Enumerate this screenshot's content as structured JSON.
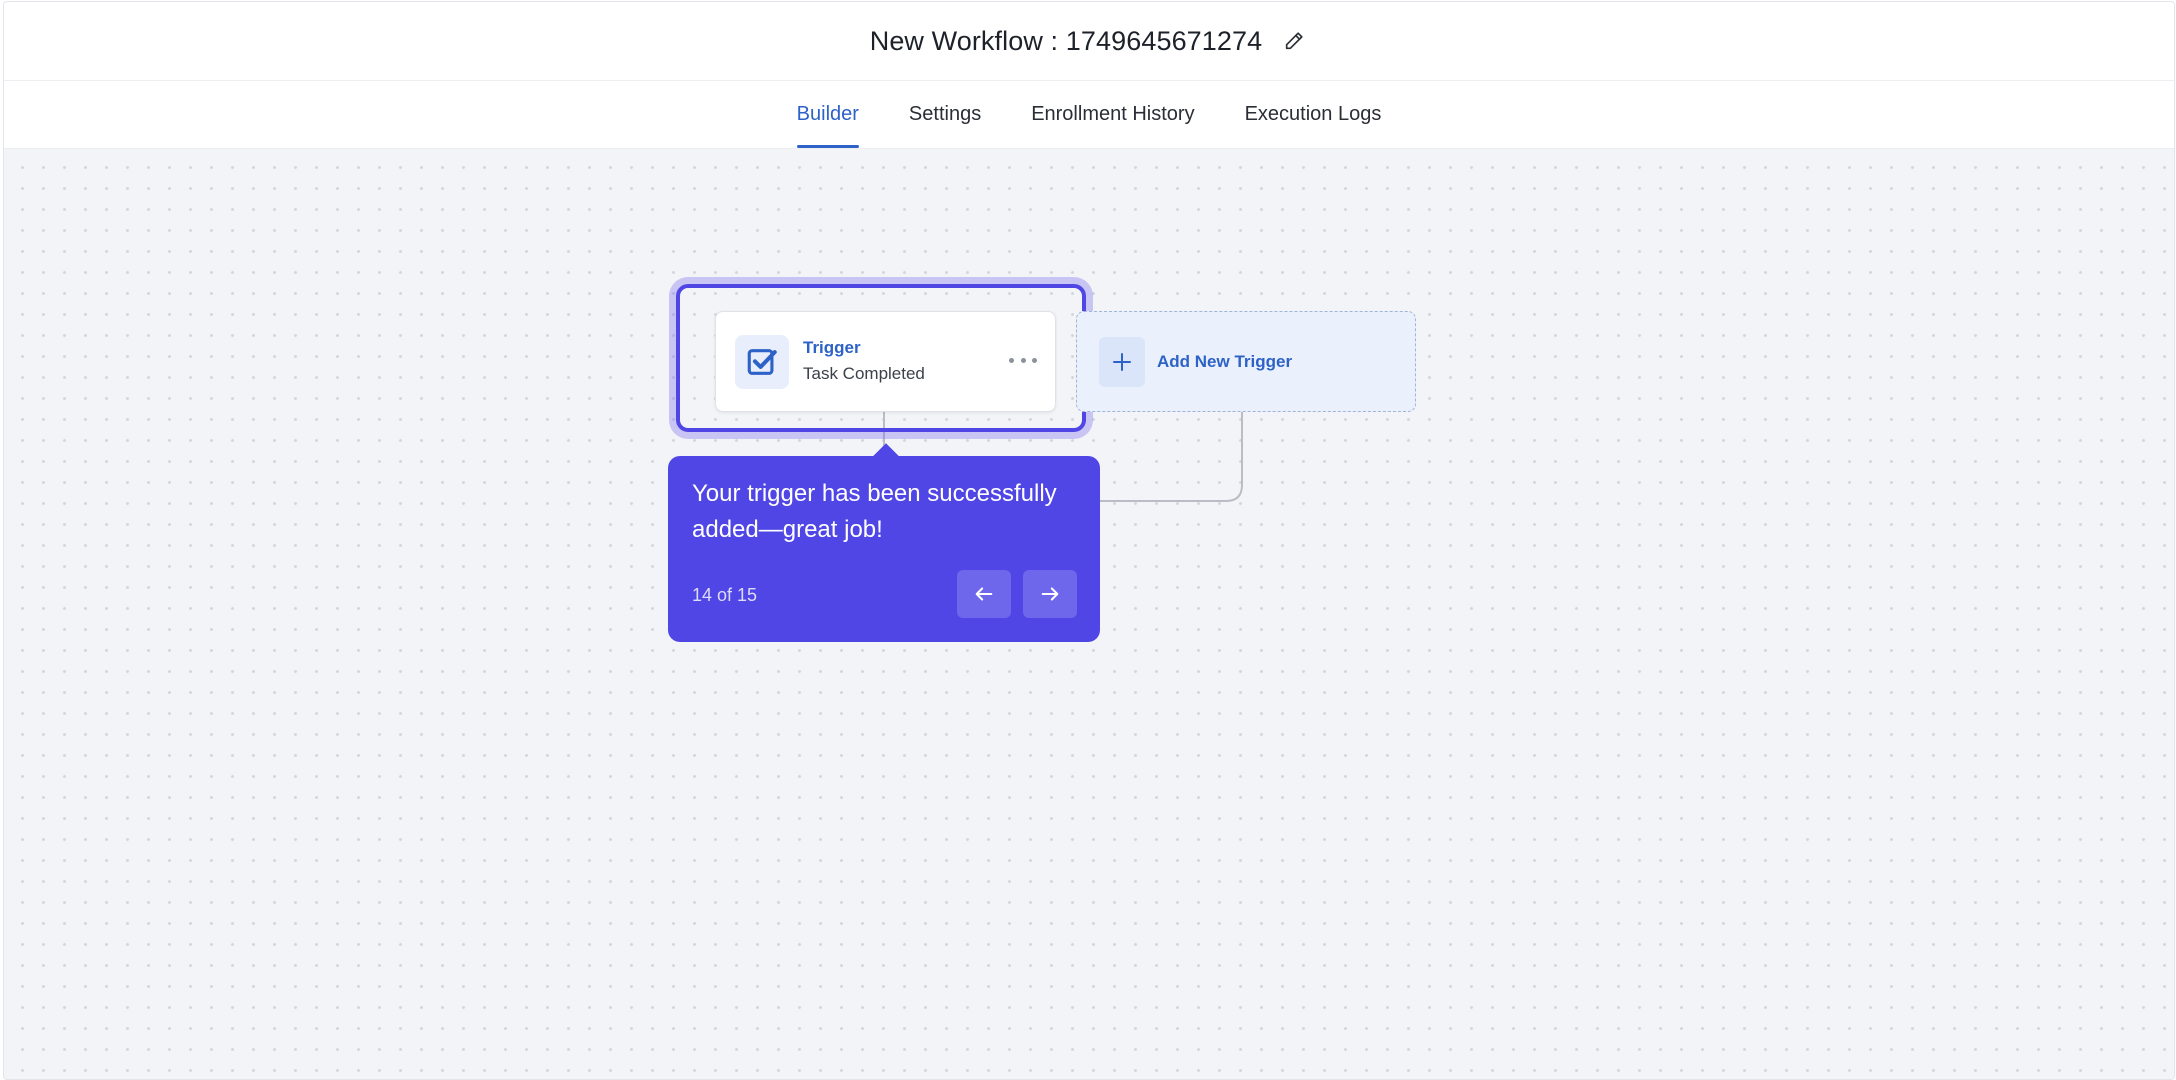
{
  "header": {
    "title": "New Workflow : 1749645671274",
    "edit_icon": "pencil-icon"
  },
  "tabs": [
    {
      "label": "Builder",
      "active": true
    },
    {
      "label": "Settings",
      "active": false
    },
    {
      "label": "Enrollment History",
      "active": false
    },
    {
      "label": "Execution Logs",
      "active": false
    }
  ],
  "canvas": {
    "trigger_node": {
      "label": "Trigger",
      "subtitle": "Task Completed",
      "icon": "checkbox-checked-icon",
      "menu_icon": "more-horizontal-icon"
    },
    "add_trigger": {
      "label": "Add New Trigger",
      "icon": "plus-icon"
    }
  },
  "tour_tooltip": {
    "message": "Your trigger has been successfully added—great job!",
    "step": "14 of 15",
    "prev_icon": "arrow-left-icon",
    "next_icon": "arrow-right-icon"
  },
  "colors": {
    "accent": "#2d62c7",
    "tour": "#4f46e5",
    "canvas_bg": "#f3f4f7"
  }
}
